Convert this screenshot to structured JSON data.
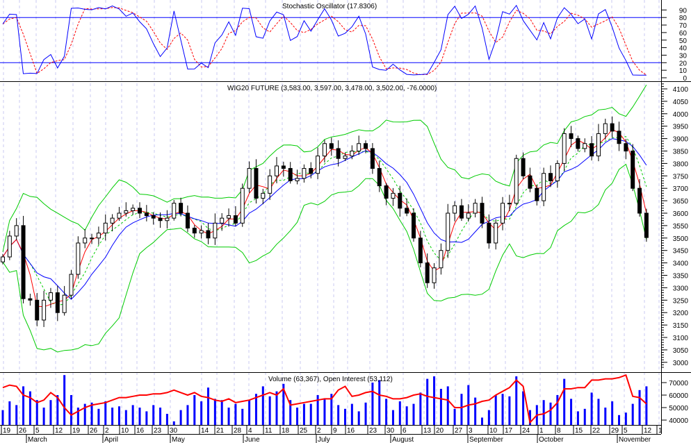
{
  "chart_data": {
    "type": "candlestick",
    "panels": {
      "stochastic": {
        "title": "Stochastic Oscillator (17.8306)",
        "levels": [
          20,
          80
        ],
        "ticks": [
          "0",
          "10",
          "20",
          "30",
          "40",
          "50",
          "60",
          "70",
          "80",
          "90"
        ],
        "ylim": [
          0,
          100
        ]
      },
      "price": {
        "title": "WIG20 FUTURE (3,583.00, 3,597.00, 3,478.00, 3,502.00, -76.0000)",
        "ticks": [
          "3000",
          "3050",
          "3100",
          "3150",
          "3200",
          "3250",
          "3300",
          "3350",
          "3400",
          "3450",
          "3500",
          "3550",
          "3600",
          "3650",
          "3700",
          "3750",
          "3800",
          "3850",
          "3900",
          "3950",
          "4000",
          "4050",
          "4100"
        ],
        "ylim": [
          2980,
          4130
        ]
      },
      "volume": {
        "title": "Volume (63,367), Open Interest (53,112)",
        "ticks": [
          "40000",
          "50000",
          "60000",
          "70000"
        ],
        "ylim": [
          33000,
          78000
        ]
      }
    },
    "x_axis": {
      "days": [
        "19",
        "26",
        "5",
        "12",
        "19",
        "26",
        "2",
        "10",
        "16",
        "23",
        "30",
        "14",
        "21",
        "28",
        "4",
        "11",
        "18",
        "25",
        "2",
        "9",
        "16",
        "23",
        "30",
        "6",
        "13",
        "20",
        "27",
        "3",
        "10",
        "17",
        "24",
        "1",
        "8",
        "15",
        "22",
        "29",
        "5",
        "12",
        "1"
      ],
      "months": [
        "March",
        "April",
        "May",
        "June",
        "July",
        "August",
        "September",
        "October",
        "November"
      ]
    },
    "close": [
      3424,
      3508,
      3550,
      3256,
      3250,
      3170,
      3250,
      3280,
      3200,
      3270,
      3354,
      3480,
      3500,
      3500,
      3520,
      3560,
      3580,
      3600,
      3610,
      3620,
      3600,
      3590,
      3580,
      3570,
      3580,
      3640,
      3600,
      3540,
      3520,
      3530,
      3500,
      3560,
      3580,
      3590,
      3560,
      3700,
      3780,
      3660,
      3680,
      3750,
      3790,
      3780,
      3730,
      3740,
      3780,
      3760,
      3830,
      3880,
      3860,
      3820,
      3830,
      3850,
      3880,
      3860,
      3780,
      3710,
      3660,
      3680,
      3620,
      3600,
      3500,
      3400,
      3320,
      3380,
      3450,
      3600,
      3630,
      3580,
      3600,
      3640,
      3560,
      3480,
      3560,
      3640,
      3640,
      3820,
      3750,
      3700,
      3650,
      3760,
      3730,
      3800,
      3920,
      3900,
      3860,
      3880,
      3830,
      3920,
      3960,
      3930,
      3880,
      3850,
      3700,
      3600,
      3502
    ],
    "volume": [
      48000,
      55000,
      52000,
      67000,
      63000,
      56000,
      50000,
      56000,
      60000,
      76000,
      60000,
      50000,
      53000,
      54000,
      49000,
      55000,
      50000,
      51000,
      48000,
      52000,
      50000,
      47000,
      52000,
      50000,
      45000,
      39000,
      48000,
      52000,
      60000,
      55000,
      66000,
      57000,
      56000,
      50000,
      53000,
      49000,
      56000,
      61000,
      67000,
      59000,
      63000,
      69000,
      56000,
      50000,
      53000,
      53000,
      60000,
      57000,
      61000,
      52000,
      49000,
      53000,
      47000,
      54000,
      70000,
      72000,
      57000,
      48000,
      55000,
      51000,
      53000,
      62000,
      73000,
      75000,
      65000,
      67000,
      49000,
      61000,
      68000,
      58000,
      42000,
      48000,
      60000,
      61000,
      59000,
      75000,
      63000,
      48000,
      52000,
      56000,
      54000,
      60000,
      73000,
      57000,
      47000,
      49000,
      62000,
      57000,
      50000,
      55000,
      44000,
      46000,
      53000,
      64000,
      67000
    ],
    "open_interest": [
      66000,
      68000,
      67000,
      60000,
      58000,
      54000,
      56000,
      62000,
      58000,
      50000,
      44000,
      47000,
      50000,
      52000,
      53000,
      54000,
      56000,
      58000,
      58000,
      59000,
      60000,
      60000,
      61000,
      61000,
      62000,
      64000,
      62000,
      60000,
      62000,
      59000,
      58000,
      56000,
      55000,
      57000,
      54000,
      55000,
      56000,
      58000,
      60000,
      62000,
      60000,
      65000,
      52000,
      53000,
      54000,
      55000,
      56000,
      57000,
      57000,
      64000,
      67000,
      59000,
      60000,
      62000,
      63000,
      60000,
      59000,
      57000,
      57000,
      58000,
      60000,
      61000,
      59000,
      58000,
      57000,
      56000,
      50000,
      50000,
      52000,
      53000,
      55000,
      56000,
      60000,
      63000,
      66000,
      72000,
      67000,
      38000,
      44000,
      45000,
      48000,
      54000,
      65000,
      65000,
      66000,
      66000,
      72000,
      72000,
      73000,
      73000,
      74000,
      76000,
      59000,
      58000,
      53000
    ]
  },
  "colors": {
    "candle": "#000000",
    "bands": "#00cc00",
    "ma_fast": "#ff0000",
    "ma_slow": "#0000ff",
    "stoch_k": "#0000ff",
    "stoch_d": "#ff0000",
    "volume": "#0000ff",
    "oi": "#ff0000",
    "grid": "#c8c8f0"
  }
}
